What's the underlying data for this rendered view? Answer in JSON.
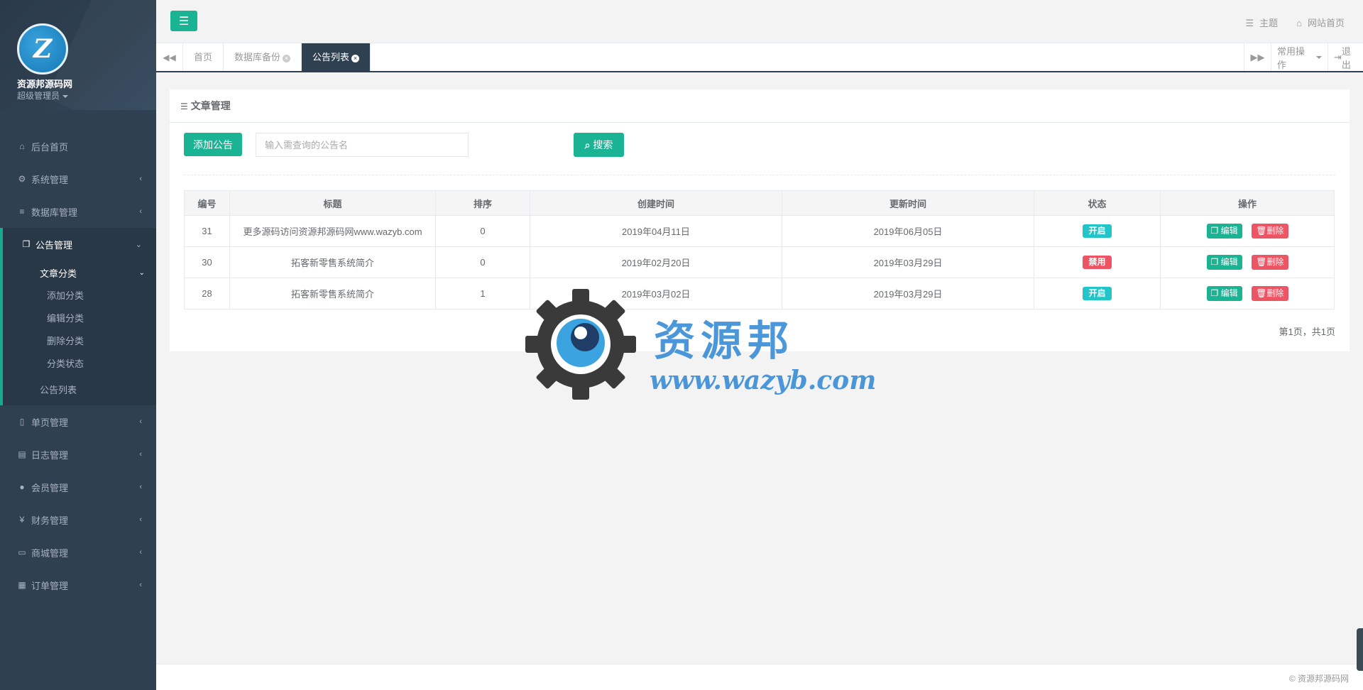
{
  "sidebar": {
    "logo_letter": "Z",
    "site_name": "资源邦源码网",
    "role": "超级管理员",
    "items": [
      {
        "label": "后台首页",
        "icon": "home-icon"
      },
      {
        "label": "系统管理",
        "icon": "gear-icon"
      },
      {
        "label": "数据库管理",
        "icon": "database-icon"
      },
      {
        "label": "公告管理",
        "icon": "copy-icon"
      },
      {
        "label": "单页管理",
        "icon": "file-icon"
      },
      {
        "label": "日志管理",
        "icon": "file-text-icon"
      },
      {
        "label": "会员管理",
        "icon": "user-icon"
      },
      {
        "label": "财务管理",
        "icon": "yen-icon"
      },
      {
        "label": "商城管理",
        "icon": "desktop-icon"
      },
      {
        "label": "订单管理",
        "icon": "file-doc-icon"
      }
    ],
    "submenu": {
      "header": "文章分类",
      "items": [
        "添加分类",
        "编辑分类",
        "删除分类",
        "分类状态"
      ],
      "list_label": "公告列表"
    }
  },
  "topbar": {
    "theme_label": "主题",
    "home_label": "网站首页"
  },
  "tabs": [
    {
      "label": "首页",
      "closable": false
    },
    {
      "label": "数据库备份",
      "closable": true
    },
    {
      "label": "公告列表",
      "closable": true,
      "active": true
    }
  ],
  "tabs_right": {
    "ops_label": "常用操作",
    "logout_label": "退出"
  },
  "panel": {
    "title": "文章管理",
    "add_button": "添加公告",
    "search_placeholder": "输入需查询的公告名",
    "search_button": "搜索"
  },
  "table": {
    "headers": [
      "编号",
      "标题",
      "排序",
      "创建时间",
      "更新时间",
      "状态",
      "操作"
    ],
    "rows": [
      {
        "id": "31",
        "title": "更多源码访问资源邦源码网www.wazyb.com",
        "sort": "0",
        "created": "2019年04月11日",
        "updated": "2019年06月05日",
        "status": "开启",
        "status_type": "on"
      },
      {
        "id": "30",
        "title": "拓客新零售系统简介",
        "sort": "0",
        "created": "2019年02月20日",
        "updated": "2019年03月29日",
        "status": "禁用",
        "status_type": "off"
      },
      {
        "id": "28",
        "title": "拓客新零售系统简介",
        "sort": "1",
        "created": "2019年03月02日",
        "updated": "2019年03月29日",
        "status": "开启",
        "status_type": "on"
      }
    ],
    "edit_label": "编辑",
    "delete_label": "删除"
  },
  "pager": "第1页，共1页",
  "watermark": {
    "line1": "资源邦",
    "line2": "www.wazyb.com"
  },
  "footer": "© 资源邦源码网",
  "colors": {
    "sidebar": "#2f4050",
    "primary": "#1ab394",
    "danger": "#ed5565",
    "info": "#23c6c8"
  }
}
